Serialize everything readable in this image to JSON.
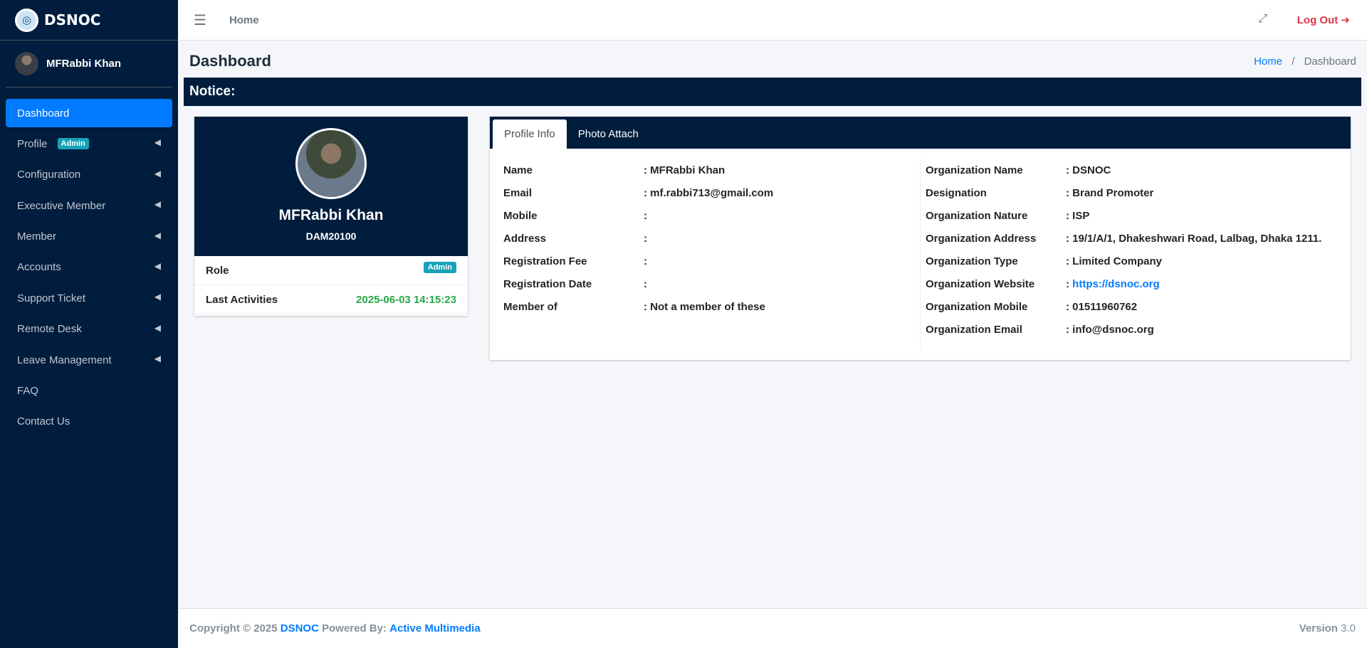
{
  "brand": {
    "name": "DSNOC",
    "logo_icon": "dsnoc-logo"
  },
  "user": {
    "name": "MFRabbi Khan"
  },
  "sidebar": {
    "items": [
      {
        "label": "Dashboard"
      },
      {
        "label": "Profile",
        "badge": "Admin"
      },
      {
        "label": "Configuration"
      },
      {
        "label": "Executive Member"
      },
      {
        "label": "Member"
      },
      {
        "label": "Accounts"
      },
      {
        "label": "Support Ticket"
      },
      {
        "label": "Remote Desk"
      },
      {
        "label": "Leave Management"
      },
      {
        "label": "FAQ"
      },
      {
        "label": "Contact Us"
      }
    ]
  },
  "topbar": {
    "home_label": "Home",
    "menu_icon": "☰",
    "expand_icon": "⤢",
    "logout_label": "Log Out",
    "logout_icon": "➜"
  },
  "page": {
    "title": "Dashboard",
    "breadcrumb": {
      "home": "Home",
      "sep": "/",
      "current": "Dashboard"
    },
    "notice": "Notice:"
  },
  "profile_card": {
    "name": "MFRabbi Khan",
    "id": "DAM20100",
    "role_label": "Role",
    "role_value": "Admin",
    "last_activities_label": "Last Activities",
    "last_activities_value": "2025-06-03 14:15:23"
  },
  "tabs": [
    {
      "label": "Profile Info"
    },
    {
      "label": "Photo Attach"
    }
  ],
  "info": {
    "left": [
      {
        "label": "Name",
        "value": ": MFRabbi Khan"
      },
      {
        "label": "Email",
        "value": ": mf.rabbi713@gmail.com"
      },
      {
        "label": "Mobile",
        "value": ":"
      },
      {
        "label": "Address",
        "value": ":"
      },
      {
        "label": "Registration Fee",
        "value": ":"
      },
      {
        "label": "Registration Date",
        "value": ":"
      },
      {
        "label": "Member of",
        "value": ": Not a member of these"
      }
    ],
    "right": [
      {
        "label": "Organization Name",
        "value": ": DSNOC"
      },
      {
        "label": "Designation",
        "value": ": Brand Promoter"
      },
      {
        "label": "Organization Nature",
        "value": ": ISP"
      },
      {
        "label": "Organization Address",
        "value": ": 19/1/A/1, Dhakeshwari Road, Lalbag, Dhaka 1211."
      },
      {
        "label": "Organization Type",
        "value": ": Limited Company"
      },
      {
        "label": "Organization Website",
        "value_prefix": ": ",
        "value_link": "https://dsnoc.org"
      },
      {
        "label": "Organization Mobile",
        "value": ": 01511960762"
      },
      {
        "label": "Organization Email",
        "value": ": info@dsnoc.org"
      }
    ]
  },
  "footer": {
    "copyright": "Copyright © 2025",
    "brand": "DSNOC",
    "powered": "Powered By:",
    "powered_link": "Active Multimedia",
    "version_label": "Version",
    "version_value": "3.0"
  },
  "colors": {
    "sidebar_bg": "#001d3d",
    "accent": "#007bff",
    "danger": "#dc3545",
    "success": "#28a745",
    "badge": "#17a2b8"
  }
}
